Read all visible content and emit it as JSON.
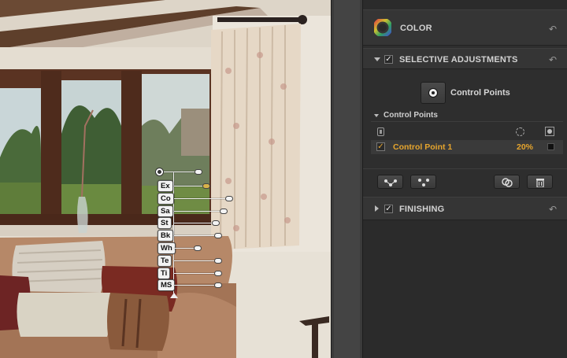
{
  "panel": {
    "color_section": {
      "title": "COLOR",
      "icon": "color-wheel-icon",
      "reset_icon": "undo-arrow-icon"
    },
    "selective_section": {
      "title": "SELECTIVE ADJUSTMENTS",
      "enabled": true,
      "add_control_point_label": "Control Points",
      "list_title": "Control Points",
      "columns": [
        "visibility",
        "opacity",
        "mask"
      ],
      "items": [
        {
          "name": "Control Point 1",
          "checked": true,
          "opacity": "20%"
        }
      ],
      "toolbar": [
        "group-points-icon",
        "ungroup-points-icon",
        "duplicate-point-icon",
        "trash-icon"
      ]
    },
    "finishing_section": {
      "title": "FINISHING",
      "enabled": true
    }
  },
  "control_point": {
    "sliders": [
      "Ex",
      "Co",
      "Sa",
      "St",
      "Bk",
      "Wh",
      "Te",
      "Ti",
      "MS"
    ],
    "accent": "#d8b24a"
  },
  "colors": {
    "highlight_text": "#e6a52d",
    "panel_bg": "#2e2e2e"
  }
}
